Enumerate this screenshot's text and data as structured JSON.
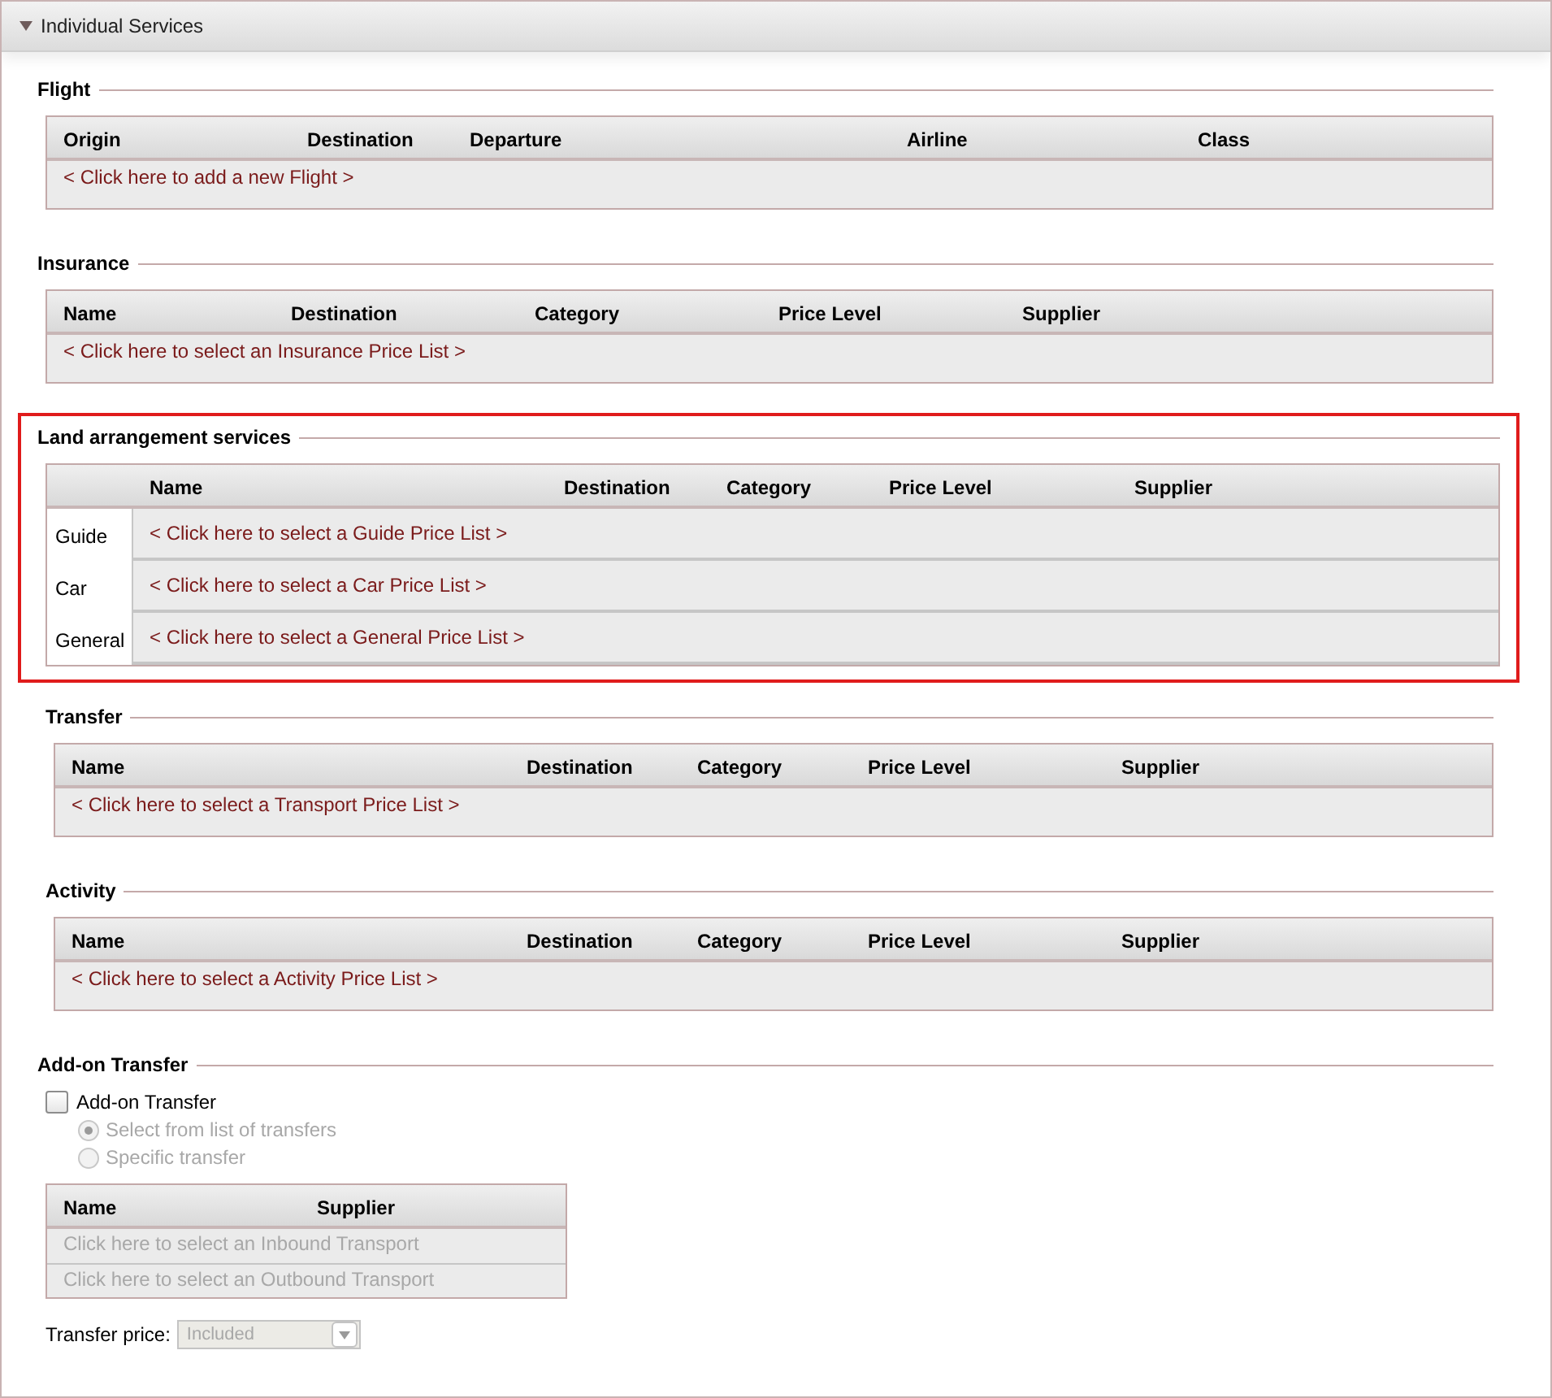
{
  "panel": {
    "title": "Individual Services",
    "expanded": true
  },
  "sections": [
    {
      "kind": "table",
      "title": "Flight",
      "highlighted": false,
      "columns": [
        "Origin",
        "Destination",
        "Departure",
        "Airline",
        "Class"
      ],
      "rows": [
        {
          "link": "< Click here to add a new Flight >"
        }
      ]
    },
    {
      "kind": "table",
      "title": "Insurance",
      "highlighted": false,
      "columns": [
        "Name",
        "Destination",
        "Category",
        "Price Level",
        "Supplier"
      ],
      "rows": [
        {
          "link": "< Click here to select an Insurance Price List >"
        }
      ]
    },
    {
      "kind": "grouped",
      "title": "Land arrangement services",
      "highlighted": true,
      "columns": [
        "Name",
        "Destination",
        "Category",
        "Price Level",
        "Supplier"
      ],
      "rows": [
        {
          "label": "Guide",
          "link": "< Click here to select a Guide Price List >"
        },
        {
          "label": "Car",
          "link": "< Click here to select a Car Price List >"
        },
        {
          "label": "General",
          "link": "< Click here to select a General Price List >"
        }
      ]
    },
    {
      "kind": "table",
      "title": "Transfer",
      "highlighted": false,
      "columns": [
        "Name",
        "Destination",
        "Category",
        "Price Level",
        "Supplier"
      ],
      "rows": [
        {
          "link": "< Click here to select a Transport Price List >"
        }
      ]
    },
    {
      "kind": "table",
      "title": "Activity",
      "highlighted": false,
      "columns": [
        "Name",
        "Destination",
        "Category",
        "Price Level",
        "Supplier"
      ],
      "rows": [
        {
          "link": "< Click here to select a Activity Price List >"
        }
      ]
    },
    {
      "kind": "addon",
      "title": "Add-on Transfer",
      "highlighted": false,
      "checkbox": {
        "label": "Add-on Transfer",
        "checked": false
      },
      "options": [
        {
          "label": "Select from list of transfers",
          "selected": true,
          "disabled": true
        },
        {
          "label": "Specific transfer",
          "selected": false,
          "disabled": true
        }
      ],
      "columns": [
        "Name",
        "Supplier"
      ],
      "rows": [
        {
          "link": "Click here to select an Inbound Transport",
          "disabled": true
        },
        {
          "link": "Click here to select an Outbound Transport",
          "disabled": true
        }
      ],
      "price": {
        "label": "Transfer price:",
        "value": "Included",
        "disabled": true
      }
    }
  ]
}
